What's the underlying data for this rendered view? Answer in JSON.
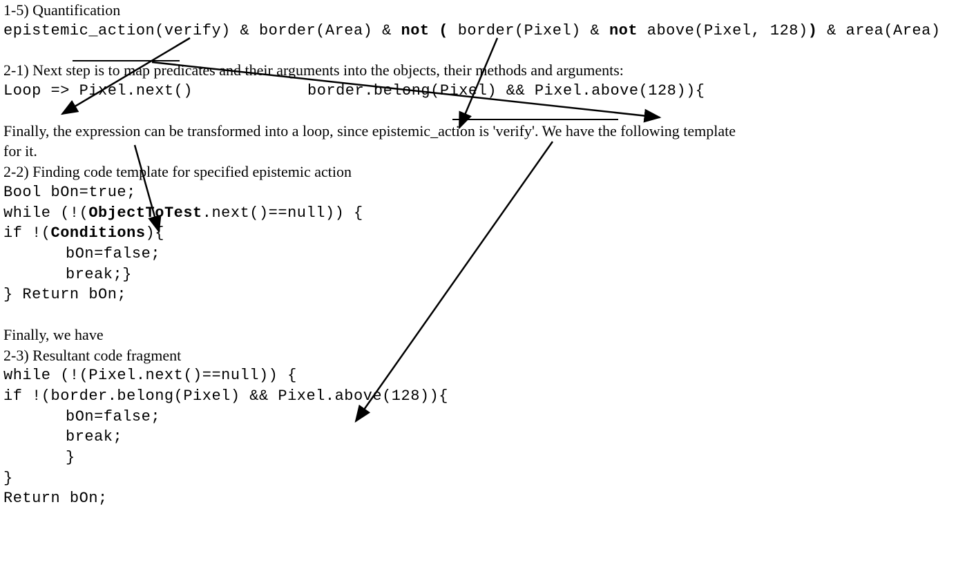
{
  "section1_5": {
    "heading": "1-5) Quantification",
    "code_part1": "epistemic_action(verify)  &  border(Area)  &  ",
    "code_not1": "not ( ",
    "code_part2": "border(Pixel)  &  ",
    "code_not2": "not",
    "code_part3": " above(Pixel, 128)",
    "code_closeparen": ")",
    "code_part4": "  &  area(Area)"
  },
  "section2_1": {
    "heading": "2-1) Next step is to map predicates and their arguments into the objects, their methods and arguments:",
    "code_left": "Loop => Pixel.next()",
    "code_right": "border.belong(Pixel)  && Pixel.above(128)){"
  },
  "para_finally1_a": "Finally, the expression can be transformed into a loop, since epistemic_action is 'verify'. We have the following template",
  "para_finally1_b": "for it.",
  "section2_2": {
    "heading": "2-2) Finding code template for specified epistemic action",
    "line1": "Bool bOn=true;",
    "line2a": "while (!(",
    "line2b": "ObjectToTest",
    "line2c": ".next()==null)) {",
    "line3a": "if !(",
    "line3b": "Conditions",
    "line3c": "){",
    "line4": "bOn=false;",
    "line5": "break;}",
    "line6": "} Return bOn;"
  },
  "para_finally2": "Finally, we have",
  "section2_3": {
    "heading": "2-3) Resultant code fragment",
    "line1": "while (!(Pixel.next()==null)) {",
    "line2": "if !(border.belong(Pixel) && Pixel.above(128)){",
    "line3": "bOn=false;",
    "line4": "break;",
    "line5": "}",
    "line6": "}",
    "line7": "Return bOn;"
  }
}
